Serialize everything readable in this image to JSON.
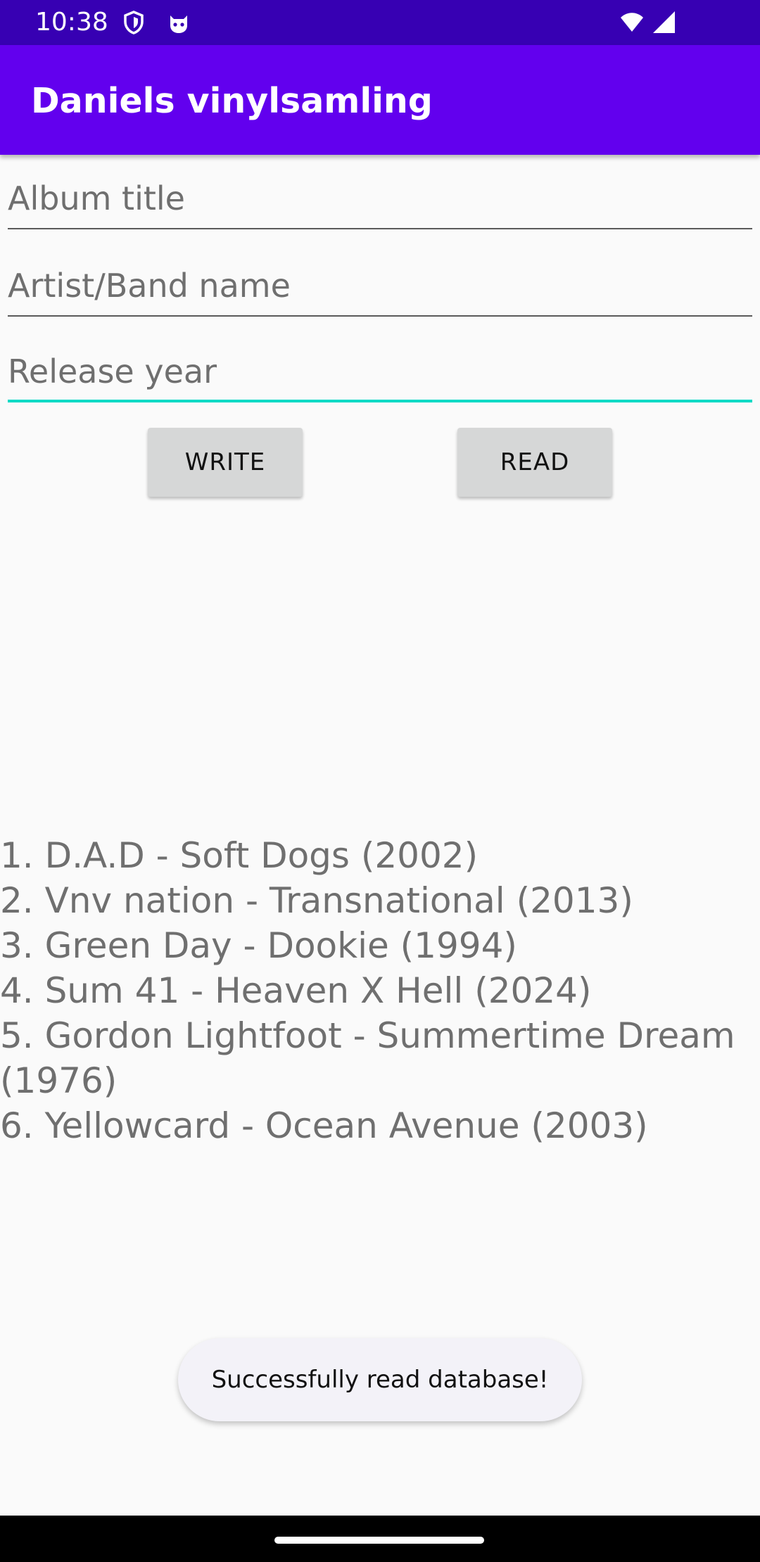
{
  "status_bar": {
    "time": "10:38",
    "left_icons": [
      "shield-icon",
      "cat-notification-icon"
    ],
    "right_icons": [
      "wifi-icon",
      "cellular-signal-icon"
    ]
  },
  "app_bar": {
    "title": "Daniels vinylsamling"
  },
  "form": {
    "album_title": {
      "placeholder": "Album title",
      "value": ""
    },
    "artist_name": {
      "placeholder": "Artist/Band name",
      "value": ""
    },
    "release_year": {
      "placeholder": "Release year",
      "value": "",
      "focused": true
    }
  },
  "buttons": {
    "write_label": "WRITE",
    "read_label": "READ"
  },
  "albums": [
    "1. D.A.D - Soft Dogs (2002)",
    "2. Vnv nation - Transnational (2013)",
    "3. Green Day - Dookie (1994)",
    "4. Sum 41 - Heaven X Hell (2024)",
    "5. Gordon Lightfoot - Summertime Dream (1976)",
    "6. Yellowcard - Ocean Avenue (2003)"
  ],
  "toast": {
    "message": "Successfully read database!"
  },
  "colors": {
    "status_bar": "#3700b3",
    "app_bar": "#6200ee",
    "focus_accent": "#03dac5",
    "background": "#fafafa"
  }
}
